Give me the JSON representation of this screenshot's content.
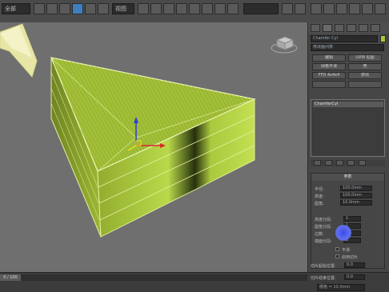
{
  "toolbar": {
    "dropdown_left": "全部",
    "dropdown_view": "视图",
    "dropdown_right": "",
    "labels": [
      "",
      "",
      ""
    ]
  },
  "viewport": {
    "object_color": "#a5c43a",
    "background": "#6f6f6f"
  },
  "panel": {
    "object_name": "Chamfer Cyl",
    "modifier_list": "修改器列表",
    "stack_item": "ChamferCyl",
    "buttons": [
      "编辑",
      "UVW 贴图",
      "网格平滑",
      "壳",
      "FFD 4x4x4",
      "挤出"
    ],
    "params_title": "参数",
    "params": [
      {
        "label": "半径:",
        "value": "100.0mm"
      },
      {
        "label": "高度:",
        "value": "100.0mm"
      },
      {
        "label": "圆角:",
        "value": "10.0mm"
      }
    ],
    "segments": [
      {
        "label": "高度分段:",
        "value": "1"
      },
      {
        "label": "圆角分段:",
        "value": "1"
      },
      {
        "label": "边数:",
        "value": "3"
      },
      {
        "label": "端面分段:",
        "value": "1"
      }
    ],
    "checks": [
      "平滑",
      "启用切片"
    ],
    "slice": [
      {
        "label": "切片起始位置:",
        "value": "0.0"
      },
      {
        "label": "切片结束位置:",
        "value": "0.0"
      }
    ]
  },
  "status": {
    "frame": "0 / 100",
    "grid": "栅格 = 10.0mm"
  }
}
